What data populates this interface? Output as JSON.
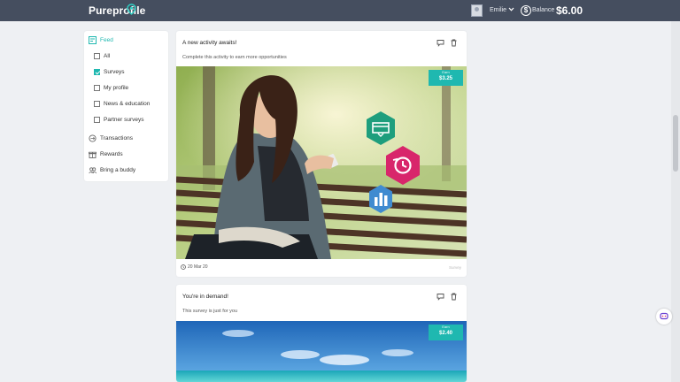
{
  "header": {
    "brand": "Pureprofile",
    "user_name": "Emilie",
    "balance_label": "Balance",
    "balance_value": "$6.00",
    "coin_symbol": "$"
  },
  "sidebar": {
    "feed_label": "Feed",
    "filters": [
      {
        "label": "All",
        "checked": false
      },
      {
        "label": "Surveys",
        "checked": true
      },
      {
        "label": "My profile",
        "checked": false
      },
      {
        "label": "News & education",
        "checked": false
      },
      {
        "label": "Partner surveys",
        "checked": false
      }
    ],
    "links": [
      {
        "label": "Transactions",
        "icon": "transactions-icon"
      },
      {
        "label": "Rewards",
        "icon": "gift-icon"
      },
      {
        "label": "Bring a buddy",
        "icon": "buddy-icon"
      }
    ]
  },
  "cards": [
    {
      "title": "A new activity awaits!",
      "subtitle": "Complete this activity to earn more opportunities",
      "reward_label": "Earn",
      "reward_value": "$3.25",
      "date": "20 Mar 20",
      "footer_right": "Survey"
    },
    {
      "title": "You're in demand!",
      "subtitle": "This survey is just for you",
      "reward_label": "Earn",
      "reward_value": "$2.40"
    }
  ],
  "colors": {
    "accent": "#1fb8b0",
    "topbar": "#454e5f",
    "background": "#eef0f3"
  }
}
